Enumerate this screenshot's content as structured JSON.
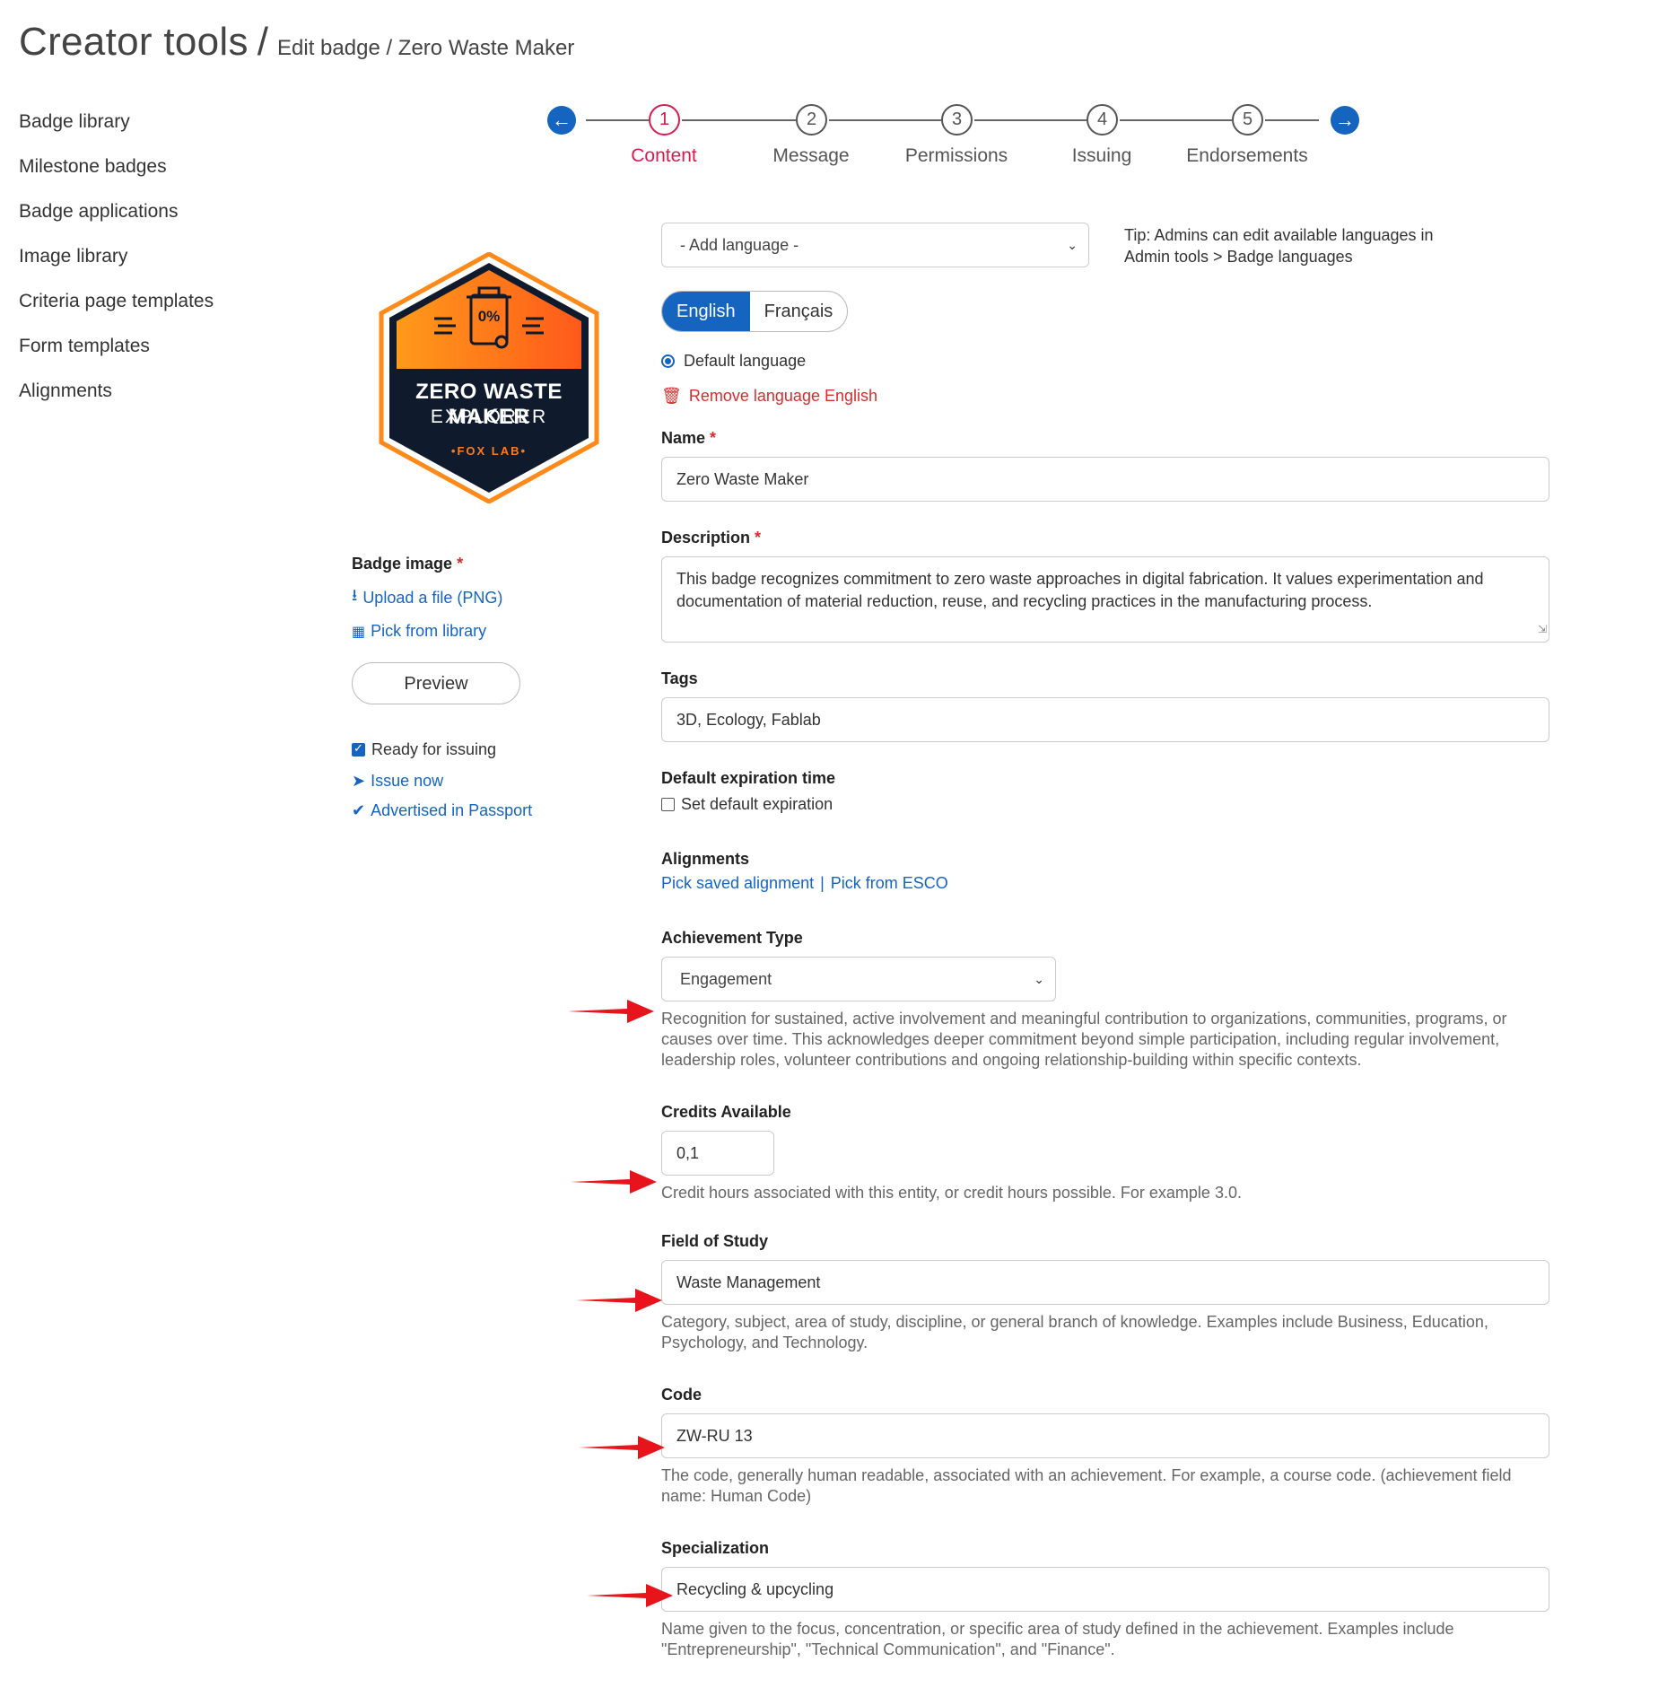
{
  "header": {
    "title": "Creator tools",
    "separator": "/",
    "breadcrumb": "Edit badge / Zero Waste Maker"
  },
  "sidebar": {
    "items": [
      {
        "label": "Badge library"
      },
      {
        "label": "Milestone badges"
      },
      {
        "label": "Badge applications"
      },
      {
        "label": "Image library"
      },
      {
        "label": "Criteria page templates"
      },
      {
        "label": "Form templates"
      },
      {
        "label": "Alignments"
      }
    ]
  },
  "stepper": {
    "prev_icon": "arrow-left-circle-icon",
    "next_icon": "arrow-right-circle-icon",
    "steps": [
      {
        "num": "1",
        "label": "Content",
        "active": true
      },
      {
        "num": "2",
        "label": "Message"
      },
      {
        "num": "3",
        "label": "Permissions"
      },
      {
        "num": "4",
        "label": "Issuing"
      },
      {
        "num": "5",
        "label": "Endorsements"
      }
    ]
  },
  "badge": {
    "image_title": "ZERO WASTE MAKER",
    "image_subtitle": "EXPLORER",
    "image_org": "•FOX LAB•",
    "image_icon_text": "0%",
    "image_label": "Badge image",
    "required_mark": "*",
    "upload_link": "Upload a file (PNG)",
    "library_link": "Pick from library",
    "preview_button": "Preview",
    "ready_label": "Ready for issuing",
    "ready_checked": true,
    "issue_link": "Issue now",
    "advertised_link": "Advertised in Passport"
  },
  "form": {
    "add_language_placeholder": "- Add language -",
    "tip_line1": "Tip: Admins can edit available languages in",
    "tip_line2": "Admin tools > Badge languages",
    "languages": [
      "English",
      "Français"
    ],
    "active_language": "English",
    "default_language_label": "Default language",
    "remove_language": "Remove language English",
    "name_label": "Name",
    "name_value": "Zero Waste Maker",
    "description_label": "Description",
    "description_value": "This badge recognizes commitment to zero waste approaches in digital fabrication. It values experimentation and documentation of material reduction, reuse, and recycling practices in the manufacturing process.",
    "tags_label": "Tags",
    "tags_value": "3D, Ecology, Fablab",
    "expiration_label": "Default expiration time",
    "expiration_checkbox": "Set default expiration",
    "alignments_label": "Alignments",
    "pick_saved_alignment": "Pick saved alignment",
    "alignment_divider": "|",
    "pick_esco": "Pick from ESCO",
    "achievement_type_label": "Achievement Type",
    "achievement_type_value": "Engagement",
    "achievement_type_help": "Recognition for sustained, active involvement and meaningful contribution to organizations, communities, programs, or causes over time. This acknowledges deeper commitment beyond simple participation, including regular involvement, leadership roles, volunteer contributions and ongoing relationship-building within specific contexts.",
    "credits_label": "Credits Available",
    "credits_value": "0,1",
    "credits_help": "Credit hours associated with this entity, or credit hours possible. For example 3.0.",
    "field_of_study_label": "Field of Study",
    "field_of_study_value": "Waste Management",
    "field_of_study_help": "Category, subject, area of study, discipline, or general branch of knowledge. Examples include Business, Education, Psychology, and Technology.",
    "code_label": "Code",
    "code_value": "ZW-RU 13",
    "code_help": "The code, generally human readable, associated with an achievement. For example, a course code. (achievement field name: Human Code)",
    "specialization_label": "Specialization",
    "specialization_value": "Recycling & upcycling",
    "specialization_help": "Name given to the focus, concentration, or specific area of study defined in the achievement. Examples include \"Entrepreneurship\", \"Technical Communication\", and \"Finance\"."
  },
  "colors": {
    "primary": "#1565c0",
    "active_step": "#d81b50",
    "danger": "#d32f2f",
    "annotation_arrow": "#e8141b",
    "badge_orange": "#ff7a1a",
    "badge_navy": "#0f1b2d"
  }
}
